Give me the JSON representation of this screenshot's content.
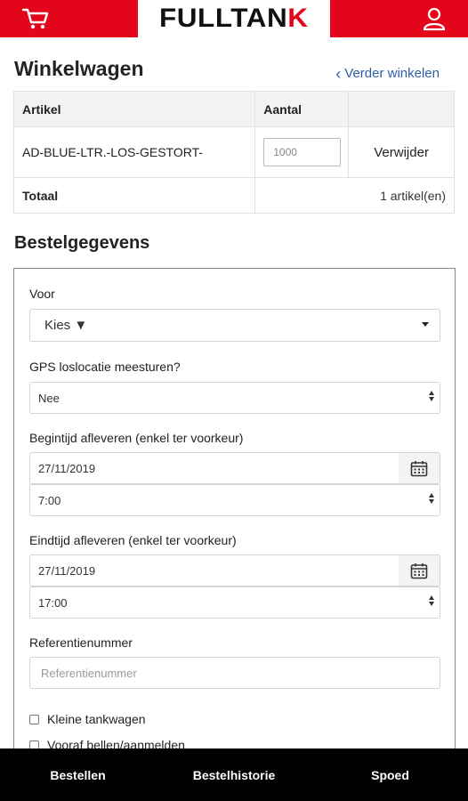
{
  "header": {
    "logo_part1": "FULLTAN",
    "logo_part2": "K",
    "cart_icon": "cart-icon",
    "user_icon": "user-icon"
  },
  "cart": {
    "title": "Winkelwagen",
    "continue_label": "Verder winkelen",
    "columns": [
      "Artikel",
      "Aantal",
      ""
    ],
    "rows": [
      {
        "article": "AD-BLUE-LTR.-LOS-GESTORT-",
        "quantity": "1000",
        "remove_label": "Verwijder"
      }
    ],
    "total_label": "Totaal",
    "total_value": "1 artikel(en)"
  },
  "order": {
    "title": "Bestelgegevens",
    "for_label": "Voor",
    "for_value": "Kies ▼",
    "gps_label": "GPS loslocatie meesturen?",
    "gps_value": "Nee",
    "start_label": "Begintijd afleveren (enkel ter voorkeur)",
    "start_date": "27/11/2019",
    "start_time": "7:00",
    "end_label": "Eindtijd afleveren (enkel ter voorkeur)",
    "end_date": "27/11/2019",
    "end_time": "17:00",
    "reference_label": "Referentienummer",
    "reference_placeholder": "Referentienummer",
    "checkboxes": [
      "Kleine tankwagen",
      "Vooraf bellen/aanmelden"
    ]
  },
  "nav": {
    "items": [
      "Bestellen",
      "Bestelhistorie",
      "Spoed"
    ]
  },
  "colors": {
    "brand_red": "#e3061a",
    "link_blue": "#2f5fa8",
    "nav_bg": "#000000"
  }
}
